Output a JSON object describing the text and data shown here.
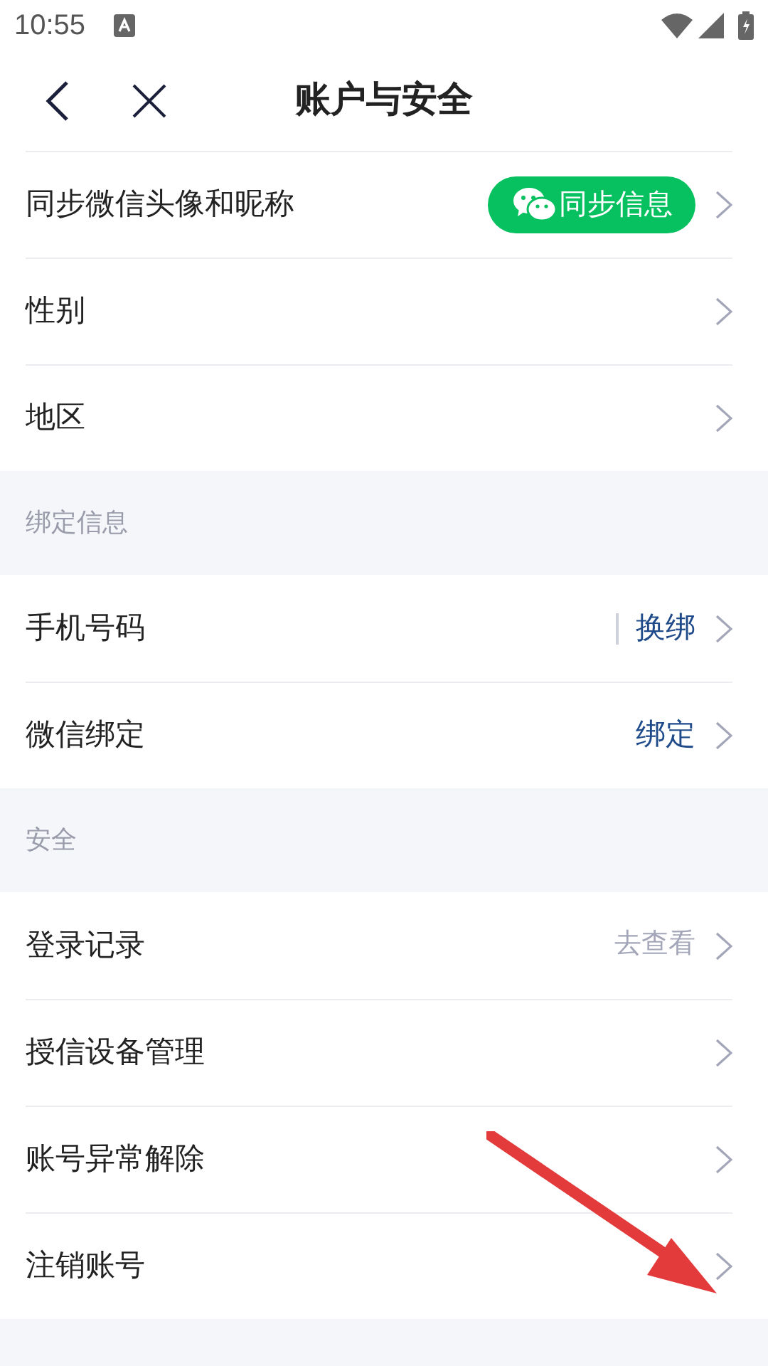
{
  "status_bar": {
    "time": "10:55"
  },
  "header": {
    "title": "账户与安全"
  },
  "groups": [
    {
      "rows": [
        {
          "label": "同步微信头像和昵称",
          "action": {
            "kind": "button",
            "text": "同步信息"
          }
        },
        {
          "label": "性别"
        },
        {
          "label": "地区"
        }
      ]
    },
    {
      "title": "绑定信息",
      "rows": [
        {
          "label": "手机号码",
          "action": {
            "kind": "link",
            "text": "换绑",
            "separator": true
          }
        },
        {
          "label": "微信绑定",
          "action": {
            "kind": "link",
            "text": "绑定",
            "separator": false
          }
        }
      ]
    },
    {
      "title": "安全",
      "rows": [
        {
          "label": "登录记录",
          "action": {
            "kind": "hint",
            "text": "去查看"
          }
        },
        {
          "label": "授信设备管理"
        },
        {
          "label": "账号异常解除"
        },
        {
          "label": "注销账号"
        }
      ]
    }
  ]
}
